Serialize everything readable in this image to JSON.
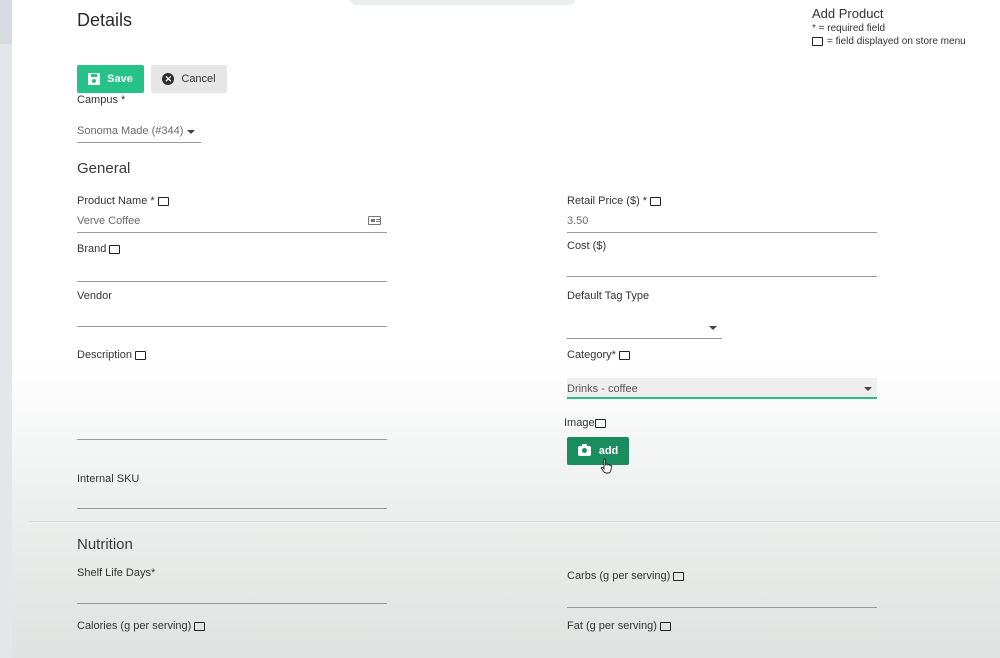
{
  "page": {
    "title": "Details"
  },
  "legend": {
    "title": "Add Product",
    "required_note": "* = required field",
    "store_menu_note": "= field displayed on store menu"
  },
  "toolbar": {
    "save_label": "Save",
    "cancel_label": "Cancel"
  },
  "campus": {
    "label": "Campus *",
    "value": "Sonoma Made (#344)"
  },
  "general": {
    "title": "General",
    "product_name": {
      "label": "Product Name *",
      "value": "Verve Coffee"
    },
    "brand": {
      "label": "Brand",
      "value": ""
    },
    "vendor": {
      "label": "Vendor",
      "value": ""
    },
    "description": {
      "label": "Description",
      "value": ""
    },
    "internal_sku": {
      "label": "Internal SKU",
      "value": ""
    },
    "retail_price": {
      "label": "Retail Price ($) *",
      "value": "3.50"
    },
    "cost": {
      "label": "Cost ($)",
      "value": ""
    },
    "default_tag_type": {
      "label": "Default Tag Type",
      "value": ""
    },
    "category": {
      "label": "Category*",
      "value": "Drinks - coffee"
    },
    "image": {
      "label": "Image",
      "add_label": "add"
    }
  },
  "nutrition": {
    "title": "Nutrition",
    "shelf_life": {
      "label": "Shelf Life Days*"
    },
    "carbs": {
      "label": "Carbs (g per serving)"
    },
    "calories": {
      "label": "Calories (g per serving)"
    },
    "fat": {
      "label": "Fat (g per serving)"
    }
  },
  "colors": {
    "primary_green": "#27c28a",
    "dark_green": "#1a8d5f",
    "focus_underline": "#2bb88b"
  }
}
